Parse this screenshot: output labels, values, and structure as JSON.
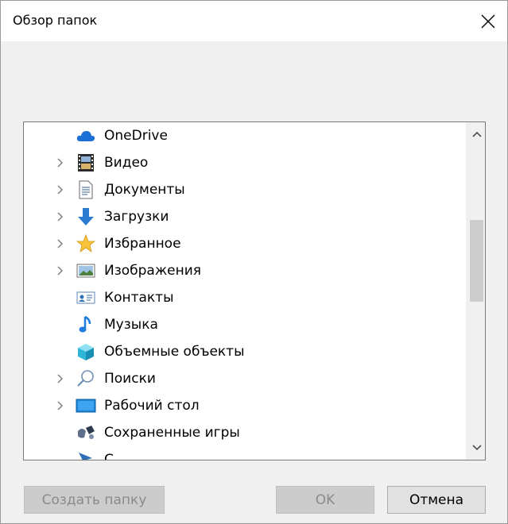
{
  "dialog": {
    "title": "Обзор папок"
  },
  "tree": {
    "items": [
      {
        "label": "OneDrive",
        "icon": "onedrive-cloud-icon",
        "expandable": false
      },
      {
        "label": "Видео",
        "icon": "video-film-icon",
        "expandable": true
      },
      {
        "label": "Документы",
        "icon": "document-icon",
        "expandable": true
      },
      {
        "label": "Загрузки",
        "icon": "download-arrow-icon",
        "expandable": true
      },
      {
        "label": "Избранное",
        "icon": "star-icon",
        "expandable": true
      },
      {
        "label": "Изображения",
        "icon": "pictures-icon",
        "expandable": true
      },
      {
        "label": "Контакты",
        "icon": "contact-card-icon",
        "expandable": false
      },
      {
        "label": "Музыка",
        "icon": "music-note-icon",
        "expandable": false
      },
      {
        "label": "Объемные объекты",
        "icon": "3d-cube-icon",
        "expandable": false
      },
      {
        "label": "Поиски",
        "icon": "search-magnifier-icon",
        "expandable": true
      },
      {
        "label": "Рабочий стол",
        "icon": "desktop-icon",
        "expandable": true
      },
      {
        "label": "Сохраненные игры",
        "icon": "saved-games-icon",
        "expandable": false
      },
      {
        "label": "С",
        "icon": "links-icon",
        "expandable": false
      }
    ]
  },
  "buttons": {
    "new_folder": "Создать папку",
    "ok": "OK",
    "cancel": "Отмена"
  }
}
